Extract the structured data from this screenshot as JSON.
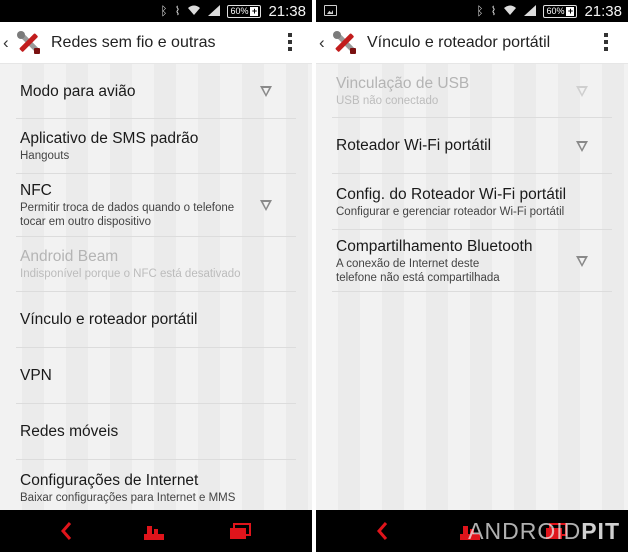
{
  "status_bar": {
    "battery": "60%",
    "time": "21:38"
  },
  "left": {
    "title": "Redes sem fio e outras",
    "items": [
      {
        "title": "Modo para avião",
        "subtitle": ""
      },
      {
        "title": "Aplicativo de SMS padrão",
        "subtitle": "Hangouts"
      },
      {
        "title": "NFC",
        "subtitle": "Permitir troca de dados quando o telefone tocar em outro dispositivo"
      },
      {
        "title": "Android Beam",
        "subtitle": "Indisponível porque o NFC está desativado"
      },
      {
        "title": "Vínculo e roteador portátil",
        "subtitle": ""
      },
      {
        "title": "VPN",
        "subtitle": ""
      },
      {
        "title": "Redes móveis",
        "subtitle": ""
      },
      {
        "title": "Configurações de Internet",
        "subtitle": "Baixar configurações para Internet e MMS"
      }
    ]
  },
  "right": {
    "title": "Vínculo e roteador portátil",
    "items": [
      {
        "title": "Vinculação de USB",
        "subtitle": "USB não conectado"
      },
      {
        "title": "Roteador Wi-Fi portátil",
        "subtitle": ""
      },
      {
        "title": "Config. do Roteador Wi-Fi portátil",
        "subtitle": "Configurar e gerenciar roteador Wi-Fi portátil"
      },
      {
        "title": "Compartilhamento Bluetooth",
        "subtitle": "A conexão de Internet deste telefone não está compartilhada"
      }
    ]
  },
  "watermark": {
    "part1": "ANDROID",
    "part2": "PIT"
  },
  "colors": {
    "nav_accent": "#e0141b",
    "statusbar": "#000000",
    "divider": "#dcdcdc"
  }
}
